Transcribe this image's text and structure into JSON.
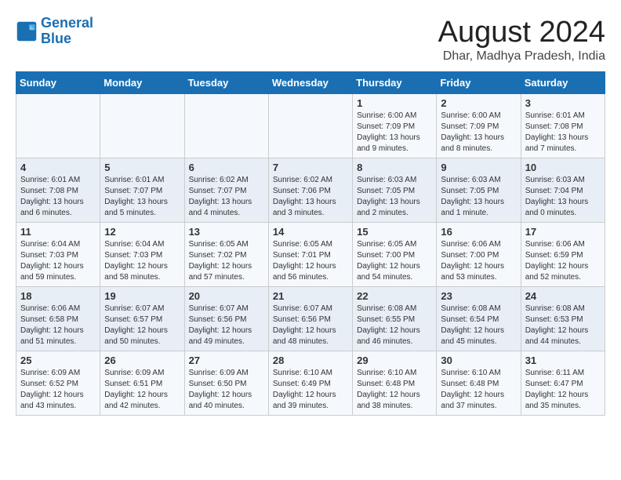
{
  "header": {
    "logo_line1": "General",
    "logo_line2": "Blue",
    "month": "August 2024",
    "location": "Dhar, Madhya Pradesh, India"
  },
  "weekdays": [
    "Sunday",
    "Monday",
    "Tuesday",
    "Wednesday",
    "Thursday",
    "Friday",
    "Saturday"
  ],
  "weeks": [
    [
      {
        "day": "",
        "info": ""
      },
      {
        "day": "",
        "info": ""
      },
      {
        "day": "",
        "info": ""
      },
      {
        "day": "",
        "info": ""
      },
      {
        "day": "1",
        "info": "Sunrise: 6:00 AM\nSunset: 7:09 PM\nDaylight: 13 hours\nand 9 minutes."
      },
      {
        "day": "2",
        "info": "Sunrise: 6:00 AM\nSunset: 7:09 PM\nDaylight: 13 hours\nand 8 minutes."
      },
      {
        "day": "3",
        "info": "Sunrise: 6:01 AM\nSunset: 7:08 PM\nDaylight: 13 hours\nand 7 minutes."
      }
    ],
    [
      {
        "day": "4",
        "info": "Sunrise: 6:01 AM\nSunset: 7:08 PM\nDaylight: 13 hours\nand 6 minutes."
      },
      {
        "day": "5",
        "info": "Sunrise: 6:01 AM\nSunset: 7:07 PM\nDaylight: 13 hours\nand 5 minutes."
      },
      {
        "day": "6",
        "info": "Sunrise: 6:02 AM\nSunset: 7:07 PM\nDaylight: 13 hours\nand 4 minutes."
      },
      {
        "day": "7",
        "info": "Sunrise: 6:02 AM\nSunset: 7:06 PM\nDaylight: 13 hours\nand 3 minutes."
      },
      {
        "day": "8",
        "info": "Sunrise: 6:03 AM\nSunset: 7:05 PM\nDaylight: 13 hours\nand 2 minutes."
      },
      {
        "day": "9",
        "info": "Sunrise: 6:03 AM\nSunset: 7:05 PM\nDaylight: 13 hours\nand 1 minute."
      },
      {
        "day": "10",
        "info": "Sunrise: 6:03 AM\nSunset: 7:04 PM\nDaylight: 13 hours\nand 0 minutes."
      }
    ],
    [
      {
        "day": "11",
        "info": "Sunrise: 6:04 AM\nSunset: 7:03 PM\nDaylight: 12 hours\nand 59 minutes."
      },
      {
        "day": "12",
        "info": "Sunrise: 6:04 AM\nSunset: 7:03 PM\nDaylight: 12 hours\nand 58 minutes."
      },
      {
        "day": "13",
        "info": "Sunrise: 6:05 AM\nSunset: 7:02 PM\nDaylight: 12 hours\nand 57 minutes."
      },
      {
        "day": "14",
        "info": "Sunrise: 6:05 AM\nSunset: 7:01 PM\nDaylight: 12 hours\nand 56 minutes."
      },
      {
        "day": "15",
        "info": "Sunrise: 6:05 AM\nSunset: 7:00 PM\nDaylight: 12 hours\nand 54 minutes."
      },
      {
        "day": "16",
        "info": "Sunrise: 6:06 AM\nSunset: 7:00 PM\nDaylight: 12 hours\nand 53 minutes."
      },
      {
        "day": "17",
        "info": "Sunrise: 6:06 AM\nSunset: 6:59 PM\nDaylight: 12 hours\nand 52 minutes."
      }
    ],
    [
      {
        "day": "18",
        "info": "Sunrise: 6:06 AM\nSunset: 6:58 PM\nDaylight: 12 hours\nand 51 minutes."
      },
      {
        "day": "19",
        "info": "Sunrise: 6:07 AM\nSunset: 6:57 PM\nDaylight: 12 hours\nand 50 minutes."
      },
      {
        "day": "20",
        "info": "Sunrise: 6:07 AM\nSunset: 6:56 PM\nDaylight: 12 hours\nand 49 minutes."
      },
      {
        "day": "21",
        "info": "Sunrise: 6:07 AM\nSunset: 6:56 PM\nDaylight: 12 hours\nand 48 minutes."
      },
      {
        "day": "22",
        "info": "Sunrise: 6:08 AM\nSunset: 6:55 PM\nDaylight: 12 hours\nand 46 minutes."
      },
      {
        "day": "23",
        "info": "Sunrise: 6:08 AM\nSunset: 6:54 PM\nDaylight: 12 hours\nand 45 minutes."
      },
      {
        "day": "24",
        "info": "Sunrise: 6:08 AM\nSunset: 6:53 PM\nDaylight: 12 hours\nand 44 minutes."
      }
    ],
    [
      {
        "day": "25",
        "info": "Sunrise: 6:09 AM\nSunset: 6:52 PM\nDaylight: 12 hours\nand 43 minutes."
      },
      {
        "day": "26",
        "info": "Sunrise: 6:09 AM\nSunset: 6:51 PM\nDaylight: 12 hours\nand 42 minutes."
      },
      {
        "day": "27",
        "info": "Sunrise: 6:09 AM\nSunset: 6:50 PM\nDaylight: 12 hours\nand 40 minutes."
      },
      {
        "day": "28",
        "info": "Sunrise: 6:10 AM\nSunset: 6:49 PM\nDaylight: 12 hours\nand 39 minutes."
      },
      {
        "day": "29",
        "info": "Sunrise: 6:10 AM\nSunset: 6:48 PM\nDaylight: 12 hours\nand 38 minutes."
      },
      {
        "day": "30",
        "info": "Sunrise: 6:10 AM\nSunset: 6:48 PM\nDaylight: 12 hours\nand 37 minutes."
      },
      {
        "day": "31",
        "info": "Sunrise: 6:11 AM\nSunset: 6:47 PM\nDaylight: 12 hours\nand 35 minutes."
      }
    ]
  ]
}
